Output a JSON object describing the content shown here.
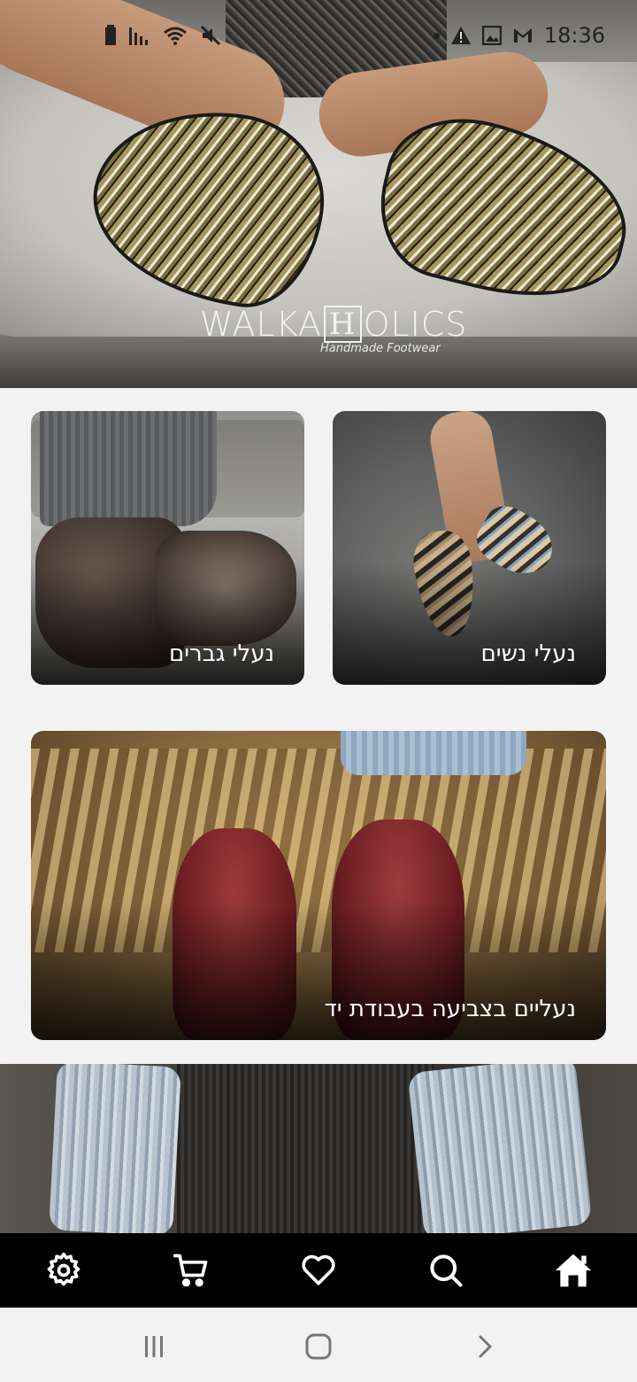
{
  "status_bar": {
    "time": "18:36",
    "left_icons": [
      "battery-icon",
      "signal-icon",
      "wifi-icon",
      "mute-icon"
    ],
    "right_icons": [
      "alert-icon",
      "image-icon",
      "gmail-icon"
    ]
  },
  "hero": {
    "logo_text_left": "WALKA",
    "logo_text_boxed": "H",
    "logo_text_right": "OLICS",
    "logo_tagline": "Handmade Footwear"
  },
  "categories": [
    {
      "id": "women",
      "label": "נעלי נשים"
    },
    {
      "id": "men",
      "label": "נעלי גברים"
    },
    {
      "id": "hand-dyed",
      "label": "נעליים בצביעה בעבודת יד"
    }
  ],
  "bottom_nav": {
    "items": [
      "settings-icon",
      "cart-icon",
      "heart-icon",
      "search-icon",
      "home-icon"
    ],
    "colors": {
      "background": "#000000",
      "icon": "#ffffff"
    }
  },
  "system_nav": {
    "items": [
      "recents-icon",
      "home-icon",
      "back-icon"
    ]
  }
}
